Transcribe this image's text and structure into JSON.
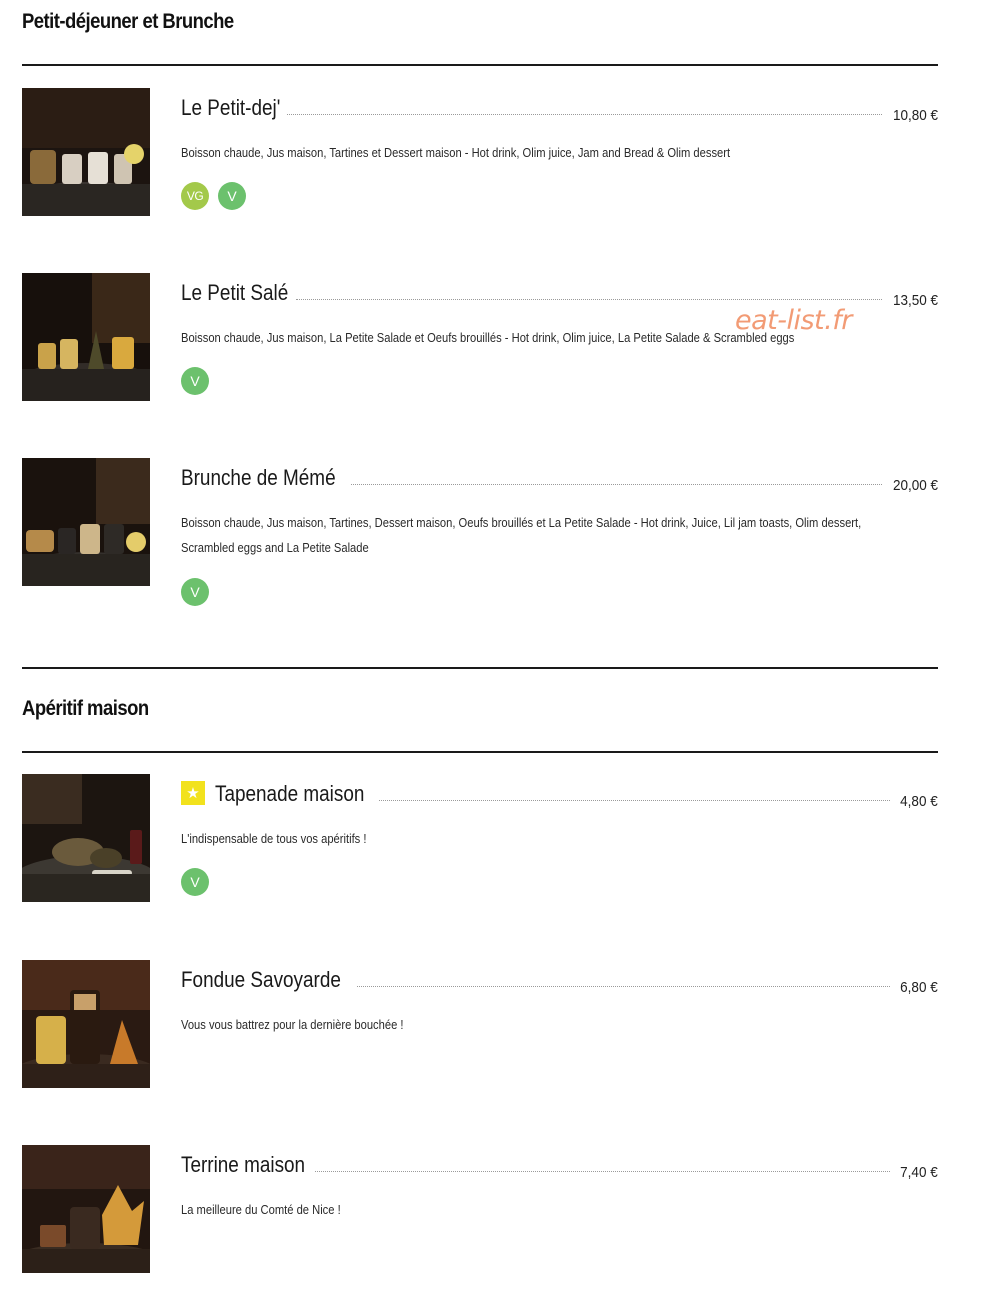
{
  "watermark": "eat-list.fr",
  "sections": [
    {
      "title": "Petit-déjeuner et Brunche",
      "items": [
        {
          "name": "Le Petit-dej'",
          "price": "10,80 €",
          "description": "Boisson chaude, Jus maison, Tartines et Dessert maison - Hot drink, Olim juice, Jam and Bread & Olim dessert",
          "badges": [
            "VG",
            "V"
          ]
        },
        {
          "name": "Le Petit Salé",
          "price": "13,50 €",
          "description": "Boisson chaude, Jus maison, La Petite Salade et Oeufs brouillés - Hot drink, Olim juice, La Petite Salade & Scrambled eggs",
          "badges": [
            "V"
          ]
        },
        {
          "name": "Brunche de Mémé",
          "price": "20,00 €",
          "description": "Boisson chaude, Jus maison, Tartines, Dessert maison, Oeufs brouillés et La Petite Salade - Hot drink, Juice, Lil jam toasts, Olim dessert, Scrambled eggs and La Petite Salade",
          "badges": [
            "V"
          ]
        }
      ]
    },
    {
      "title": "Apéritif maison",
      "items": [
        {
          "name": "Tapenade maison",
          "price": "4,80 €",
          "description": "L'indispensable de tous vos apéritifs !",
          "badges": [
            "V"
          ],
          "featured_icon": "star-icon"
        },
        {
          "name": "Fondue Savoyarde",
          "price": "6,80 €",
          "description": "Vous vous battrez pour la dernière bouchée !",
          "badges": []
        },
        {
          "name": "Terrine maison",
          "price": "7,40 €",
          "description": "La meilleure du Comté de Nice !",
          "badges": []
        }
      ]
    }
  ],
  "colors": {
    "vegan_badge": "#a3c94a",
    "vegetarian_badge": "#6cc16d",
    "featured_star": "#f2e21d",
    "rule": "#1a1a1a",
    "watermark": "#f08a5d"
  }
}
